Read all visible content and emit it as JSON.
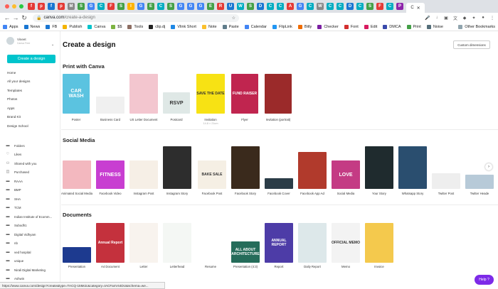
{
  "browser": {
    "tab_active_label": "C",
    "url_host": "canva.com",
    "url_path": "/create-a-design",
    "tabs": [
      {
        "glyph": "f",
        "color": "#e53935"
      },
      {
        "glyph": "p",
        "color": "#e53935"
      },
      {
        "glyph": "f",
        "color": "#1976d2"
      },
      {
        "glyph": "p",
        "color": "#e53935"
      },
      {
        "glyph": "M",
        "color": "#888888"
      },
      {
        "glyph": "S",
        "color": "#43a047"
      },
      {
        "glyph": "G",
        "color": "#4285f4"
      },
      {
        "glyph": "C",
        "color": "#00acc1"
      },
      {
        "glyph": "F",
        "color": "#e53935"
      },
      {
        "glyph": "S",
        "color": "#43a047"
      },
      {
        "glyph": "I",
        "color": "#ffb300"
      },
      {
        "glyph": "G",
        "color": "#4285f4"
      },
      {
        "glyph": "E",
        "color": "#43a047"
      },
      {
        "glyph": "C",
        "color": "#00acc1"
      },
      {
        "glyph": "S",
        "color": "#43a047"
      },
      {
        "glyph": "G",
        "color": "#4285f4"
      },
      {
        "glyph": "G",
        "color": "#4285f4"
      },
      {
        "glyph": "G",
        "color": "#4285f4"
      },
      {
        "glyph": "E",
        "color": "#43a047"
      },
      {
        "glyph": "R",
        "color": "#e53935"
      },
      {
        "glyph": "U",
        "color": "#1976d2"
      },
      {
        "glyph": "W",
        "color": "#00acc1"
      },
      {
        "glyph": "S",
        "color": "#43a047"
      },
      {
        "glyph": "D",
        "color": "#1976d2"
      },
      {
        "glyph": "C",
        "color": "#00acc1"
      },
      {
        "glyph": "C",
        "color": "#00acc1"
      },
      {
        "glyph": "A",
        "color": "#e53935"
      },
      {
        "glyph": "G",
        "color": "#4285f4"
      },
      {
        "glyph": "C",
        "color": "#00acc1"
      },
      {
        "glyph": "W",
        "color": "#888888"
      },
      {
        "glyph": "C",
        "color": "#00acc1"
      },
      {
        "glyph": "C",
        "color": "#00acc1"
      },
      {
        "glyph": "D",
        "color": "#1976d2"
      },
      {
        "glyph": "C",
        "color": "#00acc1"
      },
      {
        "glyph": "S",
        "color": "#43a047"
      },
      {
        "glyph": "F",
        "color": "#e53935"
      },
      {
        "glyph": "C",
        "color": "#00acc1"
      },
      {
        "glyph": "P",
        "color": "#8e24aa"
      }
    ],
    "bookmarks": [
      "Apps",
      "News",
      "FB",
      "Publish",
      "Canva",
      "$$",
      "Tools",
      "clip.dj",
      "Vlink Short",
      "Note",
      "Paste",
      "Calendar",
      "FlipLink",
      "Bitly",
      "Checker",
      "Font",
      "Edit",
      "DMCA",
      "Print",
      "Noise"
    ],
    "other_bookmarks": "Other Bookmarks",
    "status_url": "https://www.canva.com/design?create&type=TACQ-15Moic&category=tACFanV44DU&schema=we..."
  },
  "sidebar": {
    "user_name": "Vineet",
    "user_plan": "Canva Free",
    "create_label": "Create a design",
    "nav": [
      "Home",
      "All your designs",
      "Templates",
      "Photos",
      "Apps",
      "Brand Kit",
      "Design School"
    ],
    "folders": [
      {
        "icon": "folder-icon",
        "label": "Folders"
      },
      {
        "icon": "heart-icon",
        "label": "Likes"
      },
      {
        "icon": "people-icon",
        "label": "Shared with you"
      },
      {
        "icon": "bag-icon",
        "label": "Purchased"
      },
      {
        "icon": "folder-icon",
        "label": "RAAA"
      },
      {
        "icon": "folder-icon",
        "label": "BMP"
      },
      {
        "icon": "folder-icon",
        "label": "SHA"
      },
      {
        "icon": "folder-icon",
        "label": "TCM"
      },
      {
        "icon": "folder-icon",
        "label": "Indian Institute of Ecomm..."
      },
      {
        "icon": "folder-icon",
        "label": "Subodh1"
      },
      {
        "icon": "folder-icon",
        "label": "Digital Vidhyam"
      },
      {
        "icon": "folder-icon",
        "label": "nb"
      },
      {
        "icon": "folder-icon",
        "label": "ved hospital"
      },
      {
        "icon": "folder-icon",
        "label": "unique"
      },
      {
        "icon": "folder-icon",
        "label": "Nirali Digital Marketing"
      },
      {
        "icon": "folder-icon",
        "label": "Ashwin"
      }
    ]
  },
  "main": {
    "title": "Create a design",
    "custom_dimensions": "Custom dimensions",
    "help_label": "Help ?",
    "sections": [
      {
        "title": "Print with Canva",
        "items": [
          {
            "label": "Poster",
            "thumb": "CAR WASH",
            "bg": "#5bc3e0",
            "w": 38,
            "h": 56
          },
          {
            "label": "Business Card",
            "thumb": "",
            "bg": "#f0f0f0",
            "w": 40,
            "h": 24
          },
          {
            "label": "US Letter Document",
            "thumb": "",
            "bg": "#f3c6cf",
            "w": 40,
            "h": 56
          },
          {
            "label": "Postcard",
            "thumb": "RSVP",
            "bg": "#dfe8e6",
            "w": 38,
            "h": 30
          },
          {
            "label": "Invitation",
            "thumb": "SAVE THE DATE",
            "bg": "#f7e214",
            "w": 40,
            "h": 56,
            "sub": "14.8 × 21cm"
          },
          {
            "label": "Flyer",
            "thumb": "FUND RAISER",
            "bg": "#c0254f",
            "w": 38,
            "h": 56
          },
          {
            "label": "Invitation (portrait)",
            "thumb": "",
            "bg": "#9b2a2a",
            "w": 38,
            "h": 56
          }
        ]
      },
      {
        "title": "Social Media",
        "items": [
          {
            "label": "Animated Social Media",
            "thumb": "",
            "bg": "#f3b8bf",
            "w": 40,
            "h": 40
          },
          {
            "label": "Facebook Video",
            "thumb": "FITNESS",
            "bg": "#c83ed1",
            "w": 40,
            "h": 40
          },
          {
            "label": "Instagram Post",
            "thumb": "",
            "bg": "#f6efe6",
            "w": 40,
            "h": 40
          },
          {
            "label": "Instagram Story",
            "thumb": "",
            "bg": "#2d2d2d",
            "w": 40,
            "h": 60
          },
          {
            "label": "Facebook Post",
            "thumb": "BAKE SALE",
            "bg": "#f5efe4",
            "w": 40,
            "h": 40
          },
          {
            "label": "Facebook Story",
            "thumb": "",
            "bg": "#3a2a1c",
            "w": 40,
            "h": 60
          },
          {
            "label": "Facebook Cover",
            "thumb": "",
            "bg": "#2b3c47",
            "w": 40,
            "h": 15
          },
          {
            "label": "Facebook App Ad",
            "thumb": "",
            "bg": "#b13a2c",
            "w": 40,
            "h": 52
          },
          {
            "label": "Social Media",
            "thumb": "LOVE",
            "bg": "#c43b84",
            "w": 40,
            "h": 40
          },
          {
            "label": "Your Story",
            "thumb": "",
            "bg": "#1f2b2e",
            "w": 40,
            "h": 60
          },
          {
            "label": "Whatsapp Story",
            "thumb": "",
            "bg": "#2a4e6f",
            "w": 40,
            "h": 60
          },
          {
            "label": "Twitter Post",
            "thumb": "",
            "bg": "#eeeeee",
            "w": 40,
            "h": 22
          },
          {
            "label": "Twitter Heade",
            "thumb": "",
            "bg": "#b7cad8",
            "w": 40,
            "h": 20
          }
        ]
      },
      {
        "title": "Documents",
        "items": [
          {
            "label": "Presentation",
            "thumb": "",
            "bg": "#1d3a8f",
            "w": 40,
            "h": 22
          },
          {
            "label": "A4 Document",
            "thumb": "Annual Report",
            "bg": "#c4313d",
            "w": 40,
            "h": 56
          },
          {
            "label": "Letter",
            "thumb": "",
            "bg": "#f8f3ee",
            "w": 40,
            "h": 56
          },
          {
            "label": "Letterhead",
            "thumb": "",
            "bg": "#f4f7f4",
            "w": 40,
            "h": 56
          },
          {
            "label": "Resume",
            "thumb": "",
            "bg": "#ffffff",
            "w": 40,
            "h": 56
          },
          {
            "label": "Presentation (4:3)",
            "thumb": "ALL ABOUT ARCHITECTURE",
            "bg": "#256c5a",
            "w": 40,
            "h": 30
          },
          {
            "label": "Report",
            "thumb": "ANNUAL REPORT",
            "bg": "#4d3ca7",
            "w": 40,
            "h": 56
          },
          {
            "label": "Daily Report",
            "thumb": "",
            "bg": "#dde8ea",
            "w": 40,
            "h": 56
          },
          {
            "label": "Memo",
            "thumb": "OFFICIAL MEMO",
            "bg": "#f3f3f3",
            "w": 40,
            "h": 56
          },
          {
            "label": "Invoice",
            "thumb": "",
            "bg": "#f4c94d",
            "w": 40,
            "h": 56
          }
        ]
      }
    ]
  }
}
